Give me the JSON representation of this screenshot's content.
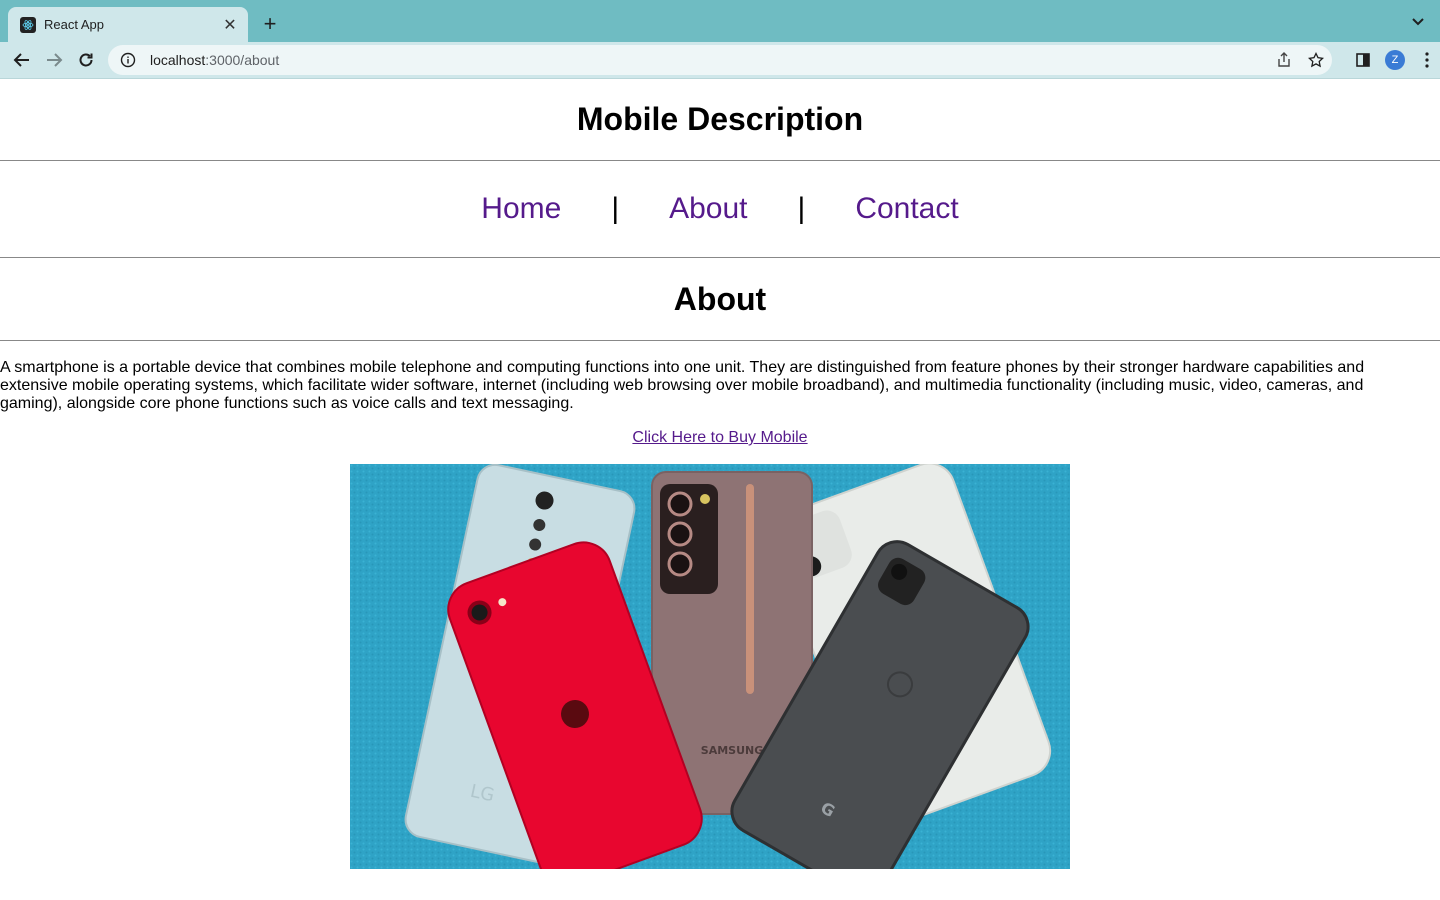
{
  "browser": {
    "tab_title": "React App",
    "url_host": "localhost",
    "url_path": ":3000/about",
    "profile_initial": "Z"
  },
  "header": {
    "title": "Mobile Description"
  },
  "nav": {
    "items": [
      {
        "label": "Home"
      },
      {
        "label": "About"
      },
      {
        "label": "Contact"
      }
    ],
    "separator": "|"
  },
  "main": {
    "heading": "About",
    "description": "A smartphone is a portable device that combines mobile telephone and computing functions into one unit. They are distinguished from feature phones by their stronger hardware capabilities and extensive mobile operating systems, which facilitate wider software, internet (including web browsing over mobile broadband), and multimedia functionality (including music, video, cameras, and gaming), alongside core phone functions such as voice calls and text messaging.",
    "buy_link": "Click Here to Buy Mobile",
    "image": {
      "phone_brands": [
        "LG",
        "SAMSUNG",
        "G"
      ]
    }
  },
  "colors": {
    "tabbar": "#6fbcc2",
    "toolbar": "#cfe7ea",
    "link": "#551a8b",
    "image_bg": "#2fa6c9"
  }
}
